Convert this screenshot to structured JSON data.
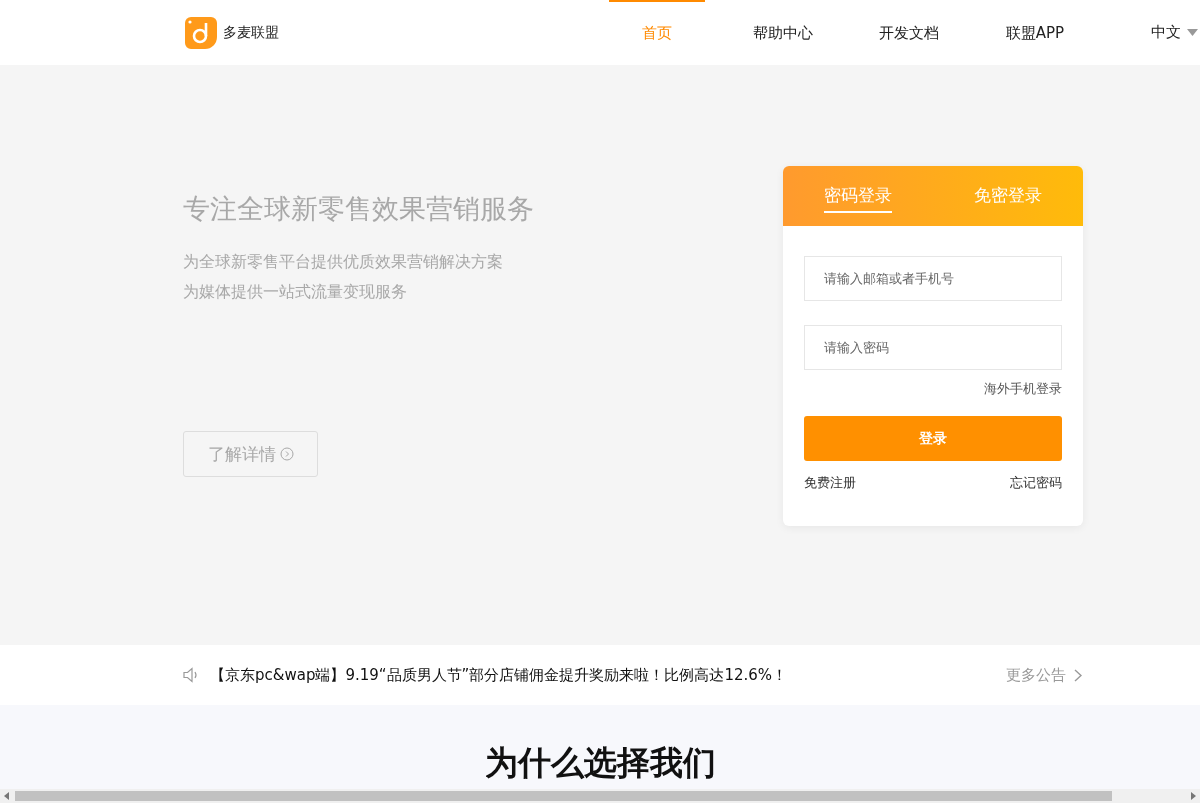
{
  "header": {
    "brand": "多麦联盟",
    "nav": [
      {
        "label": "首页",
        "selected": true
      },
      {
        "label": "帮助中心",
        "selected": false
      },
      {
        "label": "开发文档",
        "selected": false
      },
      {
        "label": "联盟APP",
        "selected": false
      }
    ],
    "language": "中文"
  },
  "hero": {
    "title": "专注全球新零售效果营销服务",
    "lines": [
      "为全球新零售平台提供优质效果营销解决方案",
      "为媒体提供一站式流量变现服务"
    ],
    "button": "了解详情"
  },
  "login": {
    "tabs": [
      {
        "label": "密码登录",
        "selected": true
      },
      {
        "label": "免密登录",
        "selected": false
      }
    ],
    "fields": [
      {
        "placeholder": "请输入邮箱或者手机号"
      },
      {
        "placeholder": "请输入密码"
      }
    ],
    "overseas_link": "海外手机登录",
    "submit": "登录",
    "register": "免费注册",
    "forgot": "忘记密码"
  },
  "notice": {
    "text": "【京东pc&wap端】9.19“品质男人节”部分店铺佣金提升奖励来啦！比例高达12.6%！",
    "more": "更多公告"
  },
  "section": {
    "title": "为什么选择我们"
  }
}
